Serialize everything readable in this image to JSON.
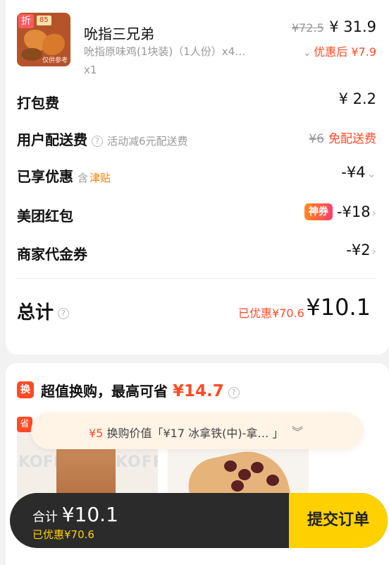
{
  "item": {
    "badge": "折",
    "image_level": "85",
    "image_watermark": "仅供参考",
    "name": "吮指三兄弟",
    "desc": "吮指原味鸡(1块装)（1人份）x4…",
    "qty": "x1",
    "orig_price": "¥72.5",
    "price": "¥ 31.9",
    "after_label": "优惠后 ¥7.9"
  },
  "fees": {
    "packing": {
      "label": "打包费",
      "value": "¥ 2.2"
    },
    "delivery": {
      "label": "用户配送费",
      "note": "活动减6元配送费",
      "orig": "¥6",
      "value": "免配送费"
    },
    "discount": {
      "label": "已享优惠",
      "note_prefix": "含",
      "note_link": "津贴",
      "value": "-¥4"
    },
    "redpack": {
      "label": "美团红包",
      "tag": "神券",
      "value": "-¥18"
    },
    "voucher": {
      "label": "商家代金券",
      "value": "-¥2"
    }
  },
  "total": {
    "label": "总计",
    "saved": "已优惠¥70.6",
    "value": "¥10.1"
  },
  "exchange": {
    "icon": "换",
    "title": "超值换购，最高可省",
    "amount": "¥14.7",
    "sheng": "省",
    "pill_price": "¥5",
    "pill_text": "换购价值「¥17 冰拿铁(中)-拿… 」",
    "products": [
      {
        "name": "iced-latte",
        "watermark": "KOFFEE"
      },
      {
        "name": "red-bean-pie"
      }
    ]
  },
  "bottom_bar": {
    "total_label": "合计",
    "total_value": "¥10.1",
    "saved": "已优惠¥70.6",
    "submit": "提交订单"
  },
  "colors": {
    "accent_red": "#ff4a26",
    "accent_yellow": "#ffd100",
    "bar_dark": "#2b2b2b"
  }
}
